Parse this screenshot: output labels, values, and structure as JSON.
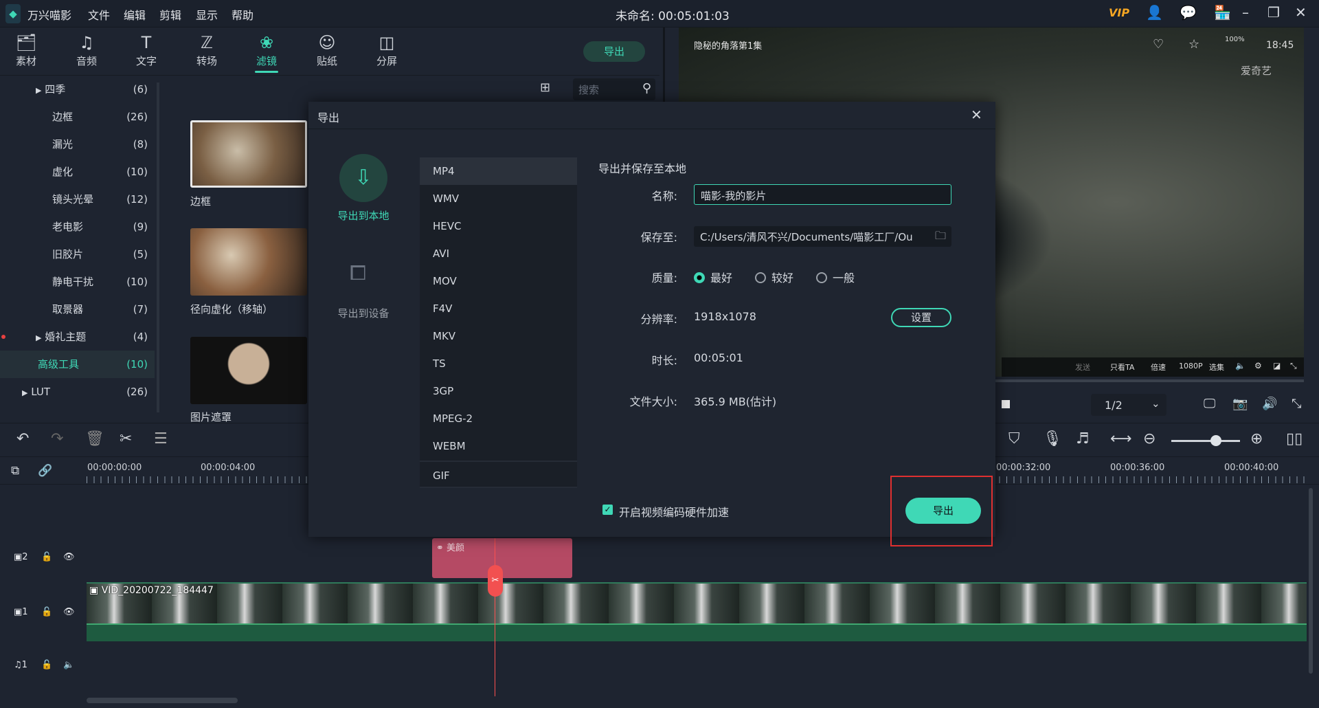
{
  "app": {
    "name": "万兴喵影",
    "menus": [
      "文件",
      "编辑",
      "剪辑",
      "显示",
      "帮助"
    ],
    "title": "未命名: 00:05:01:03",
    "vip": "VIP"
  },
  "toolbar": {
    "tools": [
      {
        "label": "素材",
        "icon": "media-icon"
      },
      {
        "label": "音频",
        "icon": "music-icon"
      },
      {
        "label": "文字",
        "icon": "text-icon"
      },
      {
        "label": "转场",
        "icon": "transition-icon"
      },
      {
        "label": "滤镜",
        "icon": "filter-icon"
      },
      {
        "label": "贴纸",
        "icon": "sticker-icon"
      },
      {
        "label": "分屏",
        "icon": "splitscreen-icon"
      }
    ],
    "export_label": "导出",
    "search_placeholder": "搜索"
  },
  "categories": [
    {
      "label": "四季",
      "count": "(6)"
    },
    {
      "label": "边框",
      "count": "(26)"
    },
    {
      "label": "漏光",
      "count": "(8)"
    },
    {
      "label": "虚化",
      "count": "(10)"
    },
    {
      "label": "镜头光晕",
      "count": "(12)"
    },
    {
      "label": "老电影",
      "count": "(9)"
    },
    {
      "label": "旧胶片",
      "count": "(5)"
    },
    {
      "label": "静电干扰",
      "count": "(10)"
    },
    {
      "label": "取景器",
      "count": "(7)"
    },
    {
      "label": "婚礼主题",
      "count": "(4)"
    },
    {
      "label": "高级工具",
      "count": "(10)"
    },
    {
      "label": "LUT",
      "count": "(26)"
    }
  ],
  "thumbs": [
    "边框",
    "径向虚化（移轴）",
    "图片遮罩"
  ],
  "preview": {
    "video_title": "隐秘的角落第1集",
    "clock": "18:45",
    "battery": "100%",
    "brand": "爱奇艺",
    "controls": [
      "只看TA",
      "倍速",
      "1080P",
      "选集"
    ],
    "send": "发送",
    "page": "1/2",
    "accent": "#3fd8b6"
  },
  "dialog": {
    "title": "导出",
    "targets": [
      "导出到本地",
      "导出到设备"
    ],
    "formats": [
      "MP4",
      "WMV",
      "HEVC",
      "AVI",
      "MOV",
      "F4V",
      "MKV",
      "TS",
      "3GP",
      "MPEG-2",
      "WEBM",
      "GIF"
    ],
    "heading": "导出并保存至本地",
    "name_label": "名称:",
    "name_value": "喵影-我的影片",
    "save_label": "保存至:",
    "save_value": "C:/Users/清风不兴/Documents/喵影工厂/Ou",
    "quality_label": "质量:",
    "quality_options": [
      "最好",
      "较好",
      "一般"
    ],
    "res_label": "分辨率:",
    "res_value": "1918x1078",
    "settings": "设置",
    "dur_label": "时长:",
    "dur_value": "00:05:01",
    "size_label": "文件大小:",
    "size_value": "365.9 MB(估计)",
    "hw_accel": "开启视频编码硬件加速",
    "export": "导出"
  },
  "timeline": {
    "ruler": [
      "00:00:00:00",
      "00:00:04:00",
      "00:00:32:00",
      "00:00:36:00",
      "00:00:40:00"
    ],
    "effect_clip": "美颜",
    "video_clip": "VID_20200722_184447",
    "tracks": [
      "2",
      "1",
      "1"
    ]
  }
}
